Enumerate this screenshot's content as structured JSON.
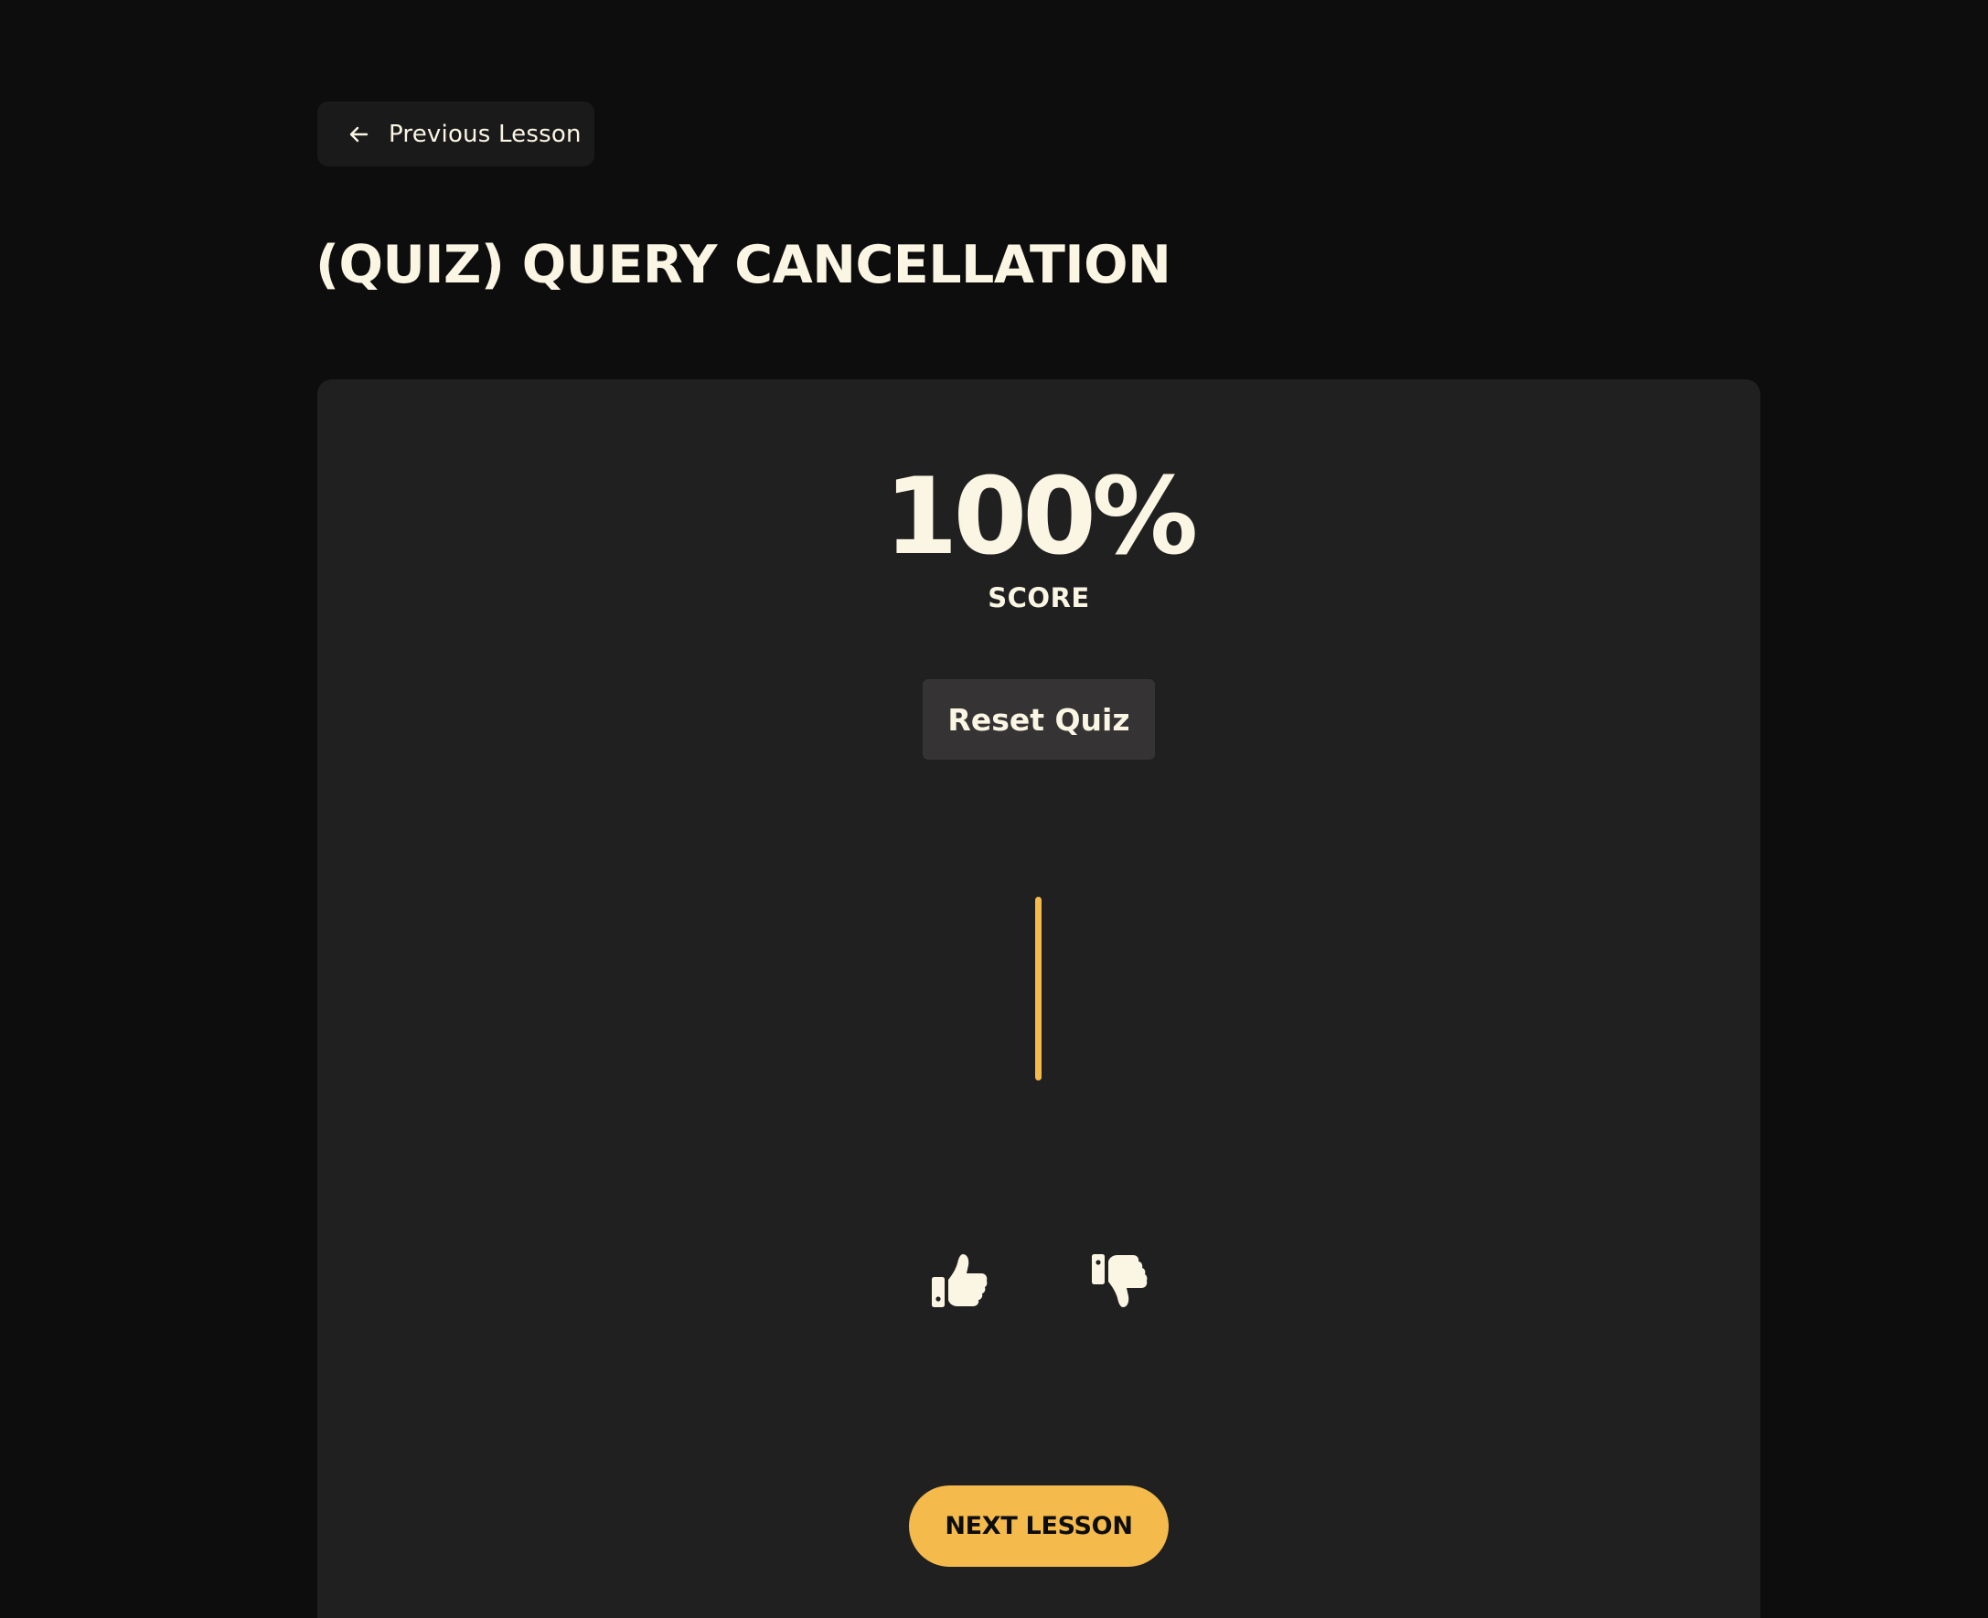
{
  "nav": {
    "previous_label": "Previous Lesson",
    "previous_icon": "arrow-left-icon"
  },
  "lesson": {
    "title": "(QUIZ) QUERY CANCELLATION"
  },
  "quiz": {
    "score_value": "100%",
    "score_label": "SCORE",
    "reset_label": "Reset Quiz",
    "progress_fraction": 1.0
  },
  "feedback": {
    "like_icon": "thumbs-up-icon",
    "dislike_icon": "thumbs-down-icon"
  },
  "footer": {
    "next_label": "NEXT LESSON"
  },
  "colors": {
    "background": "#0e0d0e",
    "card": "#212021",
    "text": "#fbf6e3",
    "accent": "#f4bb4c",
    "button": "#353334"
  }
}
